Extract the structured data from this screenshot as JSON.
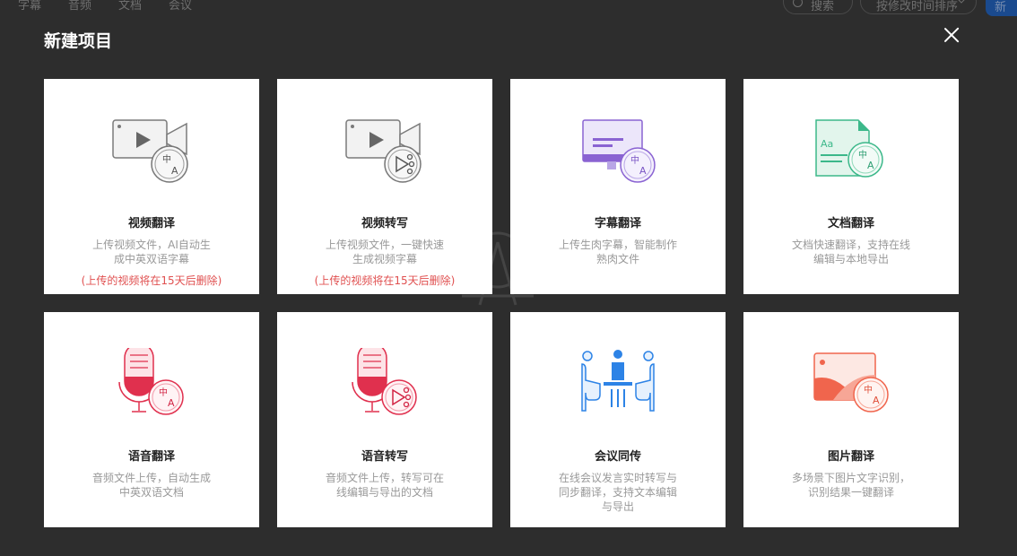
{
  "background": {
    "tabs": [
      "字幕",
      "音频",
      "文档",
      "会议"
    ],
    "search_label": "搜索",
    "sort_label": "按修改时间排序",
    "new_label": "新"
  },
  "modal": {
    "title": "新建项目",
    "close_icon": "close-icon"
  },
  "cards": [
    {
      "title": "视频翻译",
      "desc": "上传视频文件，AI自动生成中英双语字幕",
      "warning": "(上传的视频将在15天后删除)",
      "icon": "video-translate-icon",
      "accent": "#808080"
    },
    {
      "title": "视频转写",
      "desc": "上传视频文件，一键快速生成视频字幕",
      "warning": "(上传的视频将在15天后删除)",
      "icon": "video-transcribe-icon",
      "accent": "#808080"
    },
    {
      "title": "字幕翻译",
      "desc": "上传生肉字幕，智能制作熟肉文件",
      "warning": "",
      "icon": "subtitle-translate-icon",
      "accent": "#8a63d2"
    },
    {
      "title": "文档翻译",
      "desc": "文档快速翻译，支持在线编辑与本地导出",
      "warning": "",
      "icon": "document-translate-icon",
      "accent": "#3cb88a"
    },
    {
      "title": "语音翻译",
      "desc": "音频文件上传，自动生成中英双语文档",
      "warning": "",
      "icon": "audio-translate-icon",
      "accent": "#e0304e"
    },
    {
      "title": "语音转写",
      "desc": "音频文件上传，转写可在线编辑与导出的文档",
      "warning": "",
      "icon": "audio-transcribe-icon",
      "accent": "#e0304e"
    },
    {
      "title": "会议同传",
      "desc": "在线会议发言实时转写与同步翻译，支持文本编辑与导出",
      "warning": "",
      "icon": "meeting-interpret-icon",
      "accent": "#2d83e6"
    },
    {
      "title": "图片翻译",
      "desc": "多场景下图片文字识别，识别结果一键翻译",
      "warning": "",
      "icon": "image-translate-icon",
      "accent": "#f0654d"
    }
  ]
}
